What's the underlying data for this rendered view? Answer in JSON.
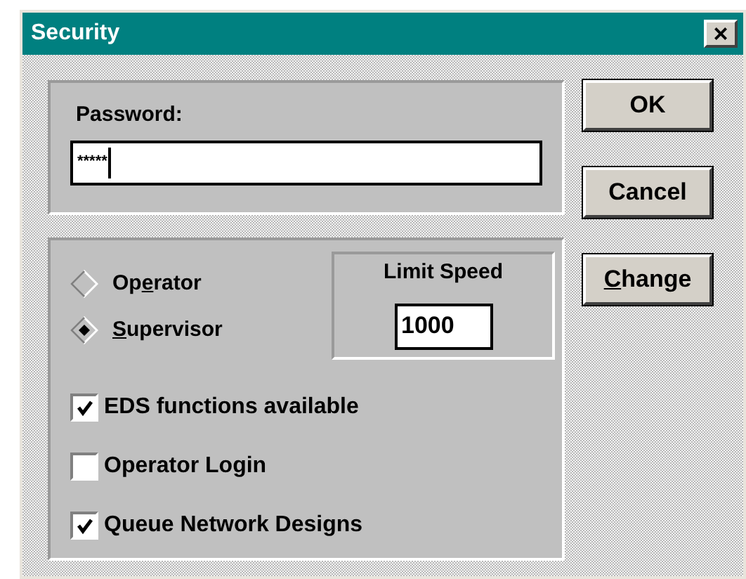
{
  "window": {
    "title": "Security",
    "close": "×"
  },
  "password": {
    "label": "Password:",
    "value": "*****"
  },
  "roles": [
    {
      "before": "Op",
      "key": "e",
      "after": "rator",
      "selected": false
    },
    {
      "key": "S",
      "after": "upervisor",
      "selected": true
    }
  ],
  "limit_speed": {
    "label": "Limit Speed",
    "value": "1000"
  },
  "options": [
    {
      "label": "EDS functions available",
      "checked": true
    },
    {
      "label": "Operator Login",
      "checked": false
    },
    {
      "label": "Queue Network Designs",
      "checked": true
    }
  ],
  "buttons": [
    {
      "after": "OK"
    },
    {
      "after": "Cancel"
    },
    {
      "key": "C",
      "after": "hange"
    }
  ]
}
